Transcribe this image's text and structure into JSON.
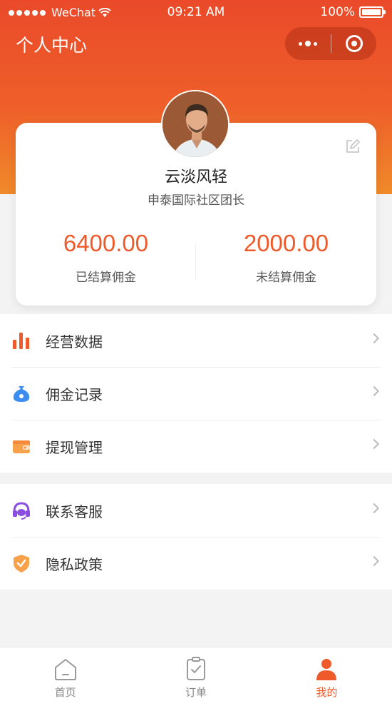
{
  "status_bar": {
    "carrier": "WeChat",
    "time": "09:21 AM",
    "battery": "100%"
  },
  "header": {
    "title": "个人中心"
  },
  "profile": {
    "name": "云淡风轻",
    "role": "申泰国际社区团长",
    "settled_amount": "6400.00",
    "settled_label": "已结算佣金",
    "unsettled_amount": "2000.00",
    "unsettled_label": "未结算佣金"
  },
  "menu": {
    "group1": [
      {
        "label": "经营数据",
        "icon": "bar-chart-icon"
      },
      {
        "label": "佣金记录",
        "icon": "money-bag-icon"
      },
      {
        "label": "提现管理",
        "icon": "wallet-icon"
      }
    ],
    "group2": [
      {
        "label": "联系客服",
        "icon": "headset-icon"
      },
      {
        "label": "隐私政策",
        "icon": "shield-icon"
      }
    ]
  },
  "tabbar": {
    "tabs": [
      {
        "label": "首页",
        "icon": "home-icon",
        "active": false
      },
      {
        "label": "订单",
        "icon": "order-icon",
        "active": false
      },
      {
        "label": "我的",
        "icon": "user-icon",
        "active": true
      }
    ]
  },
  "colors": {
    "accent": "#ef5a2a",
    "header_top": "#ea4a2a",
    "header_bottom": "#f08a2a"
  }
}
